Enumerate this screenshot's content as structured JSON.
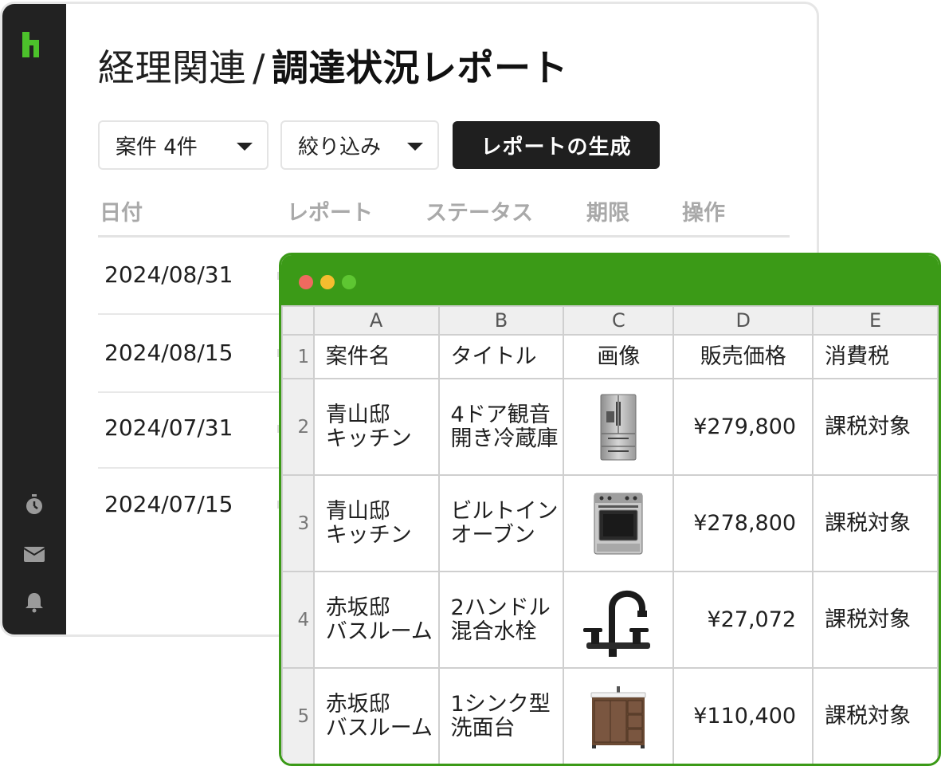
{
  "app": {
    "breadcrumb_parent": "経理関連",
    "breadcrumb_sep": "/",
    "page_title": "調達状況レポート",
    "toolbar": {
      "cases_dropdown": "案件 4件",
      "filter_dropdown": "絞り込み",
      "generate_button": "レポートの生成"
    },
    "columns": [
      "日付",
      "レポート",
      "ステータス",
      "期限",
      "操作"
    ],
    "rows": [
      {
        "date": "2024/08/31"
      },
      {
        "date": "2024/08/15"
      },
      {
        "date": "2024/07/31"
      },
      {
        "date": "2024/07/15"
      }
    ],
    "sidebar_icons": [
      "home-logo",
      "timer-icon",
      "mail-icon",
      "bell-icon"
    ]
  },
  "spreadsheet": {
    "column_letters": [
      "A",
      "B",
      "C",
      "D",
      "E"
    ],
    "header_row": {
      "row_number": "1",
      "cells": [
        "案件名",
        "タイトル",
        "画像",
        "販売価格",
        "消費税"
      ]
    },
    "rows": [
      {
        "row_number": "2",
        "project": [
          "青山邸",
          "キッチン"
        ],
        "title": [
          "4ドア観音",
          "開き冷蔵庫"
        ],
        "image": "refrigerator-image",
        "price": "¥279,800",
        "tax": "課税対象"
      },
      {
        "row_number": "3",
        "project": [
          "青山邸",
          "キッチン"
        ],
        "title": [
          "ビルトイン",
          "オーブン"
        ],
        "image": "oven-image",
        "price": "¥278,800",
        "tax": "課税対象"
      },
      {
        "row_number": "4",
        "project": [
          "赤坂邸",
          "バスルーム"
        ],
        "title": [
          "2ハンドル",
          "混合水栓"
        ],
        "image": "faucet-image",
        "price": "¥27,072",
        "tax": "課税対象"
      },
      {
        "row_number": "5",
        "project": [
          "赤坂邸",
          "バスルーム"
        ],
        "title": [
          "1シンク型",
          "洗面台"
        ],
        "image": "vanity-image",
        "price": "¥110,400",
        "tax": "課税対象"
      }
    ]
  },
  "colors": {
    "sidebar": "#222222",
    "accent_green": "#3b9a17",
    "logo_green": "#4cc22b",
    "button_dark": "#1f1f1f"
  }
}
